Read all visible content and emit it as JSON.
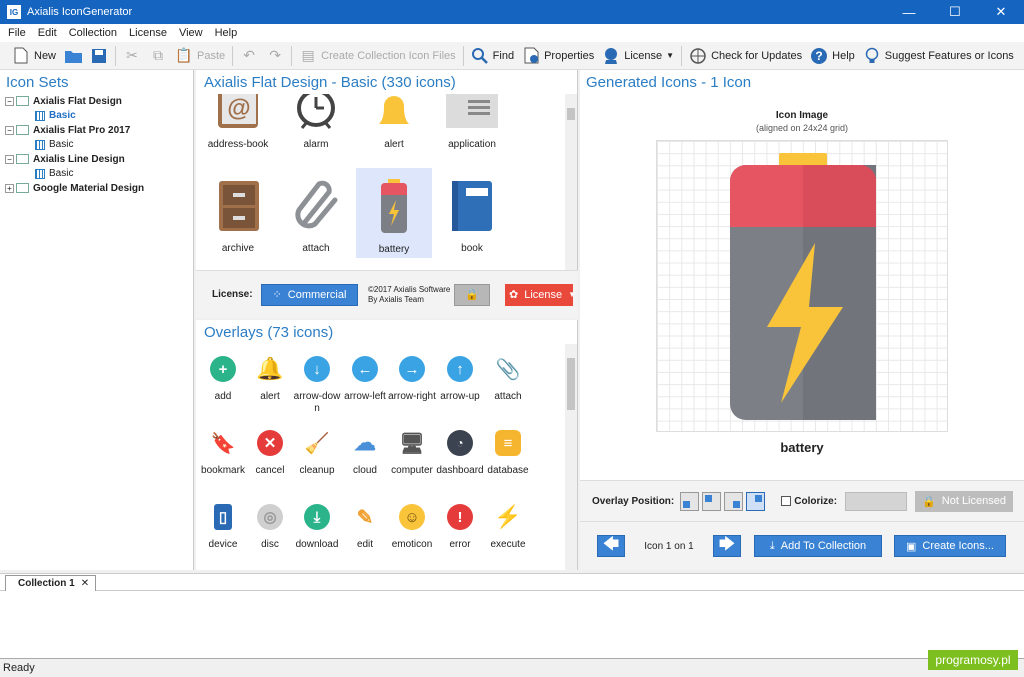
{
  "window": {
    "title": "Axialis IconGenerator",
    "app_icon": "IG",
    "controls": {
      "minimize": "—",
      "maximize": "☐",
      "close": "✕"
    }
  },
  "menu": [
    "File",
    "Edit",
    "Collection",
    "License",
    "View",
    "Help"
  ],
  "toolbar": {
    "new": "New",
    "paste": "Paste",
    "create_collection": "Create Collection Icon Files",
    "find": "Find",
    "properties": "Properties",
    "license": "License",
    "check_updates": "Check for Updates",
    "help": "Help",
    "suggest": "Suggest Features or Icons"
  },
  "icon_sets": {
    "title": "Icon Sets",
    "items": [
      {
        "label": "Axialis Flat Design",
        "bold": true
      },
      {
        "label": "Basic",
        "bold": false,
        "selected": true
      },
      {
        "label": "Axialis Flat Pro 2017",
        "bold": true
      },
      {
        "label": "Basic",
        "bold": false
      },
      {
        "label": "Axialis Line Design",
        "bold": true
      },
      {
        "label": "Basic",
        "bold": false
      },
      {
        "label": "Google Material Design",
        "bold": true
      }
    ]
  },
  "set_panel": {
    "title": "Axialis Flat Design - Basic (330 icons)",
    "icons": [
      "address-book",
      "alarm",
      "alert",
      "application",
      "archive",
      "attach",
      "battery",
      "book"
    ],
    "selected": "battery"
  },
  "license": {
    "label": "License:",
    "commercial": "Commercial",
    "copyright_line1": "©2017 Axialis Software",
    "copyright_line2": "By Axialis Team",
    "license_btn": "License"
  },
  "overlays": {
    "title": "Overlays (73 icons)",
    "items": [
      "add",
      "alert",
      "arrow-down",
      "arrow-left",
      "arrow-right",
      "arrow-up",
      "attach",
      "bookmark",
      "cancel",
      "cleanup",
      "cloud",
      "computer",
      "dashboard",
      "database",
      "device",
      "disc",
      "download",
      "edit",
      "emoticon",
      "error",
      "execute"
    ]
  },
  "generated": {
    "title": "Generated Icons - 1 Icon",
    "image_title": "Icon Image",
    "image_subtitle": "(aligned on 24x24 grid)",
    "icon_name": "battery"
  },
  "overlay_options": {
    "position_label": "Overlay Position:",
    "colorize": "Colorize:",
    "not_licensed": "Not Licensed"
  },
  "nav": {
    "counter": "Icon 1 on 1",
    "add_to_collection": "Add To Collection",
    "create_icons": "Create Icons..."
  },
  "tabs": [
    {
      "label": "Collection 1"
    }
  ],
  "status": "Ready",
  "watermark": "programosy.pl",
  "colors": {
    "accent": "#2b7dc4",
    "titlebar": "#1565c0",
    "license_red": "#e8493b",
    "battery_red": "#e65562",
    "battery_gray": "#7c7f86",
    "bolt": "#f9c43a"
  }
}
